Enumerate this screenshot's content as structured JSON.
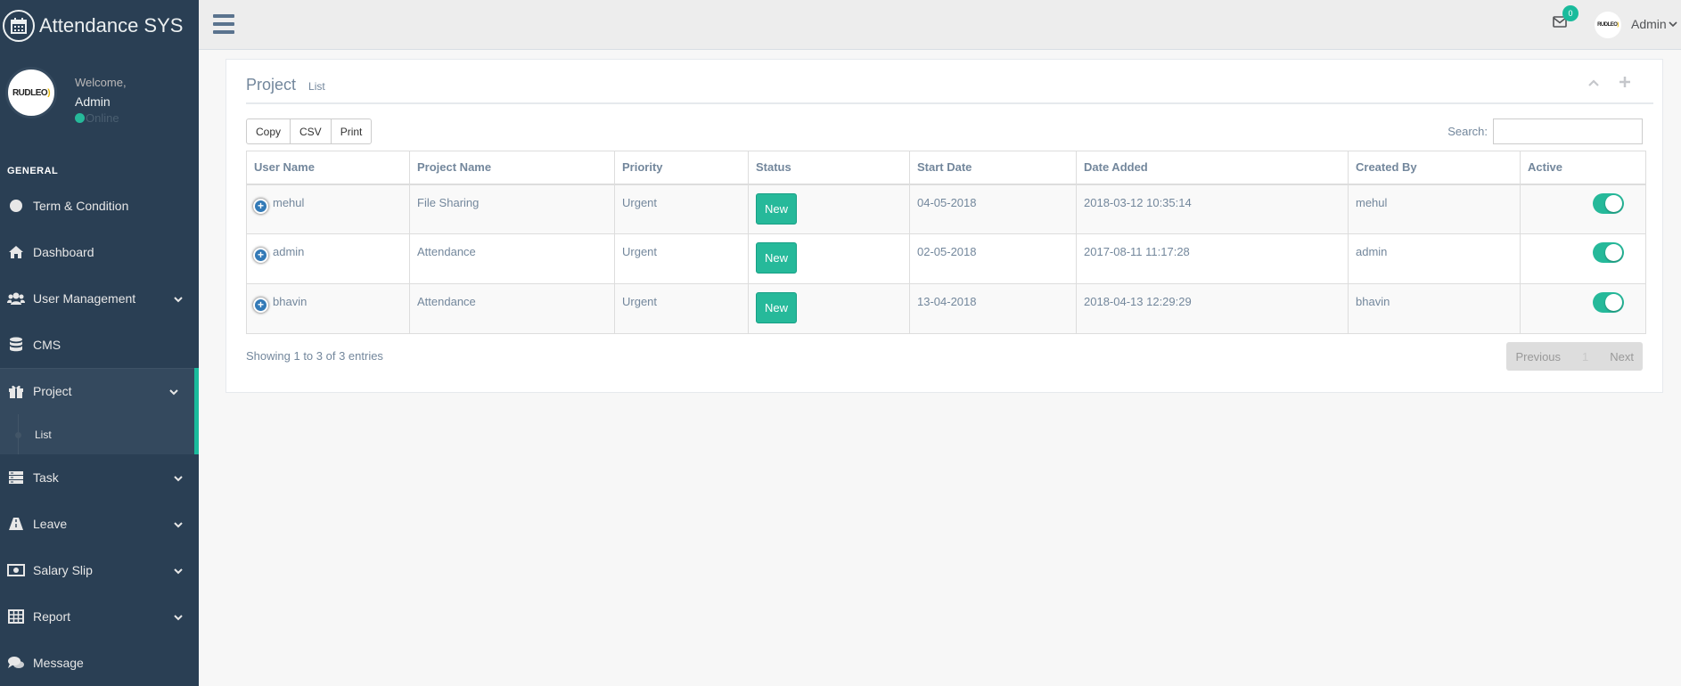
{
  "app": {
    "title": "Attendance SYS"
  },
  "profile": {
    "welcome": "Welcome,",
    "name": "Admin",
    "status": "Online"
  },
  "logo": {
    "text_main": "RUDLEO",
    "subtitle": ""
  },
  "sidebar": {
    "section": "GENERAL",
    "items": [
      {
        "label": "Term & Condition",
        "icon": "circle-icon"
      },
      {
        "label": "Dashboard",
        "icon": "home-icon"
      },
      {
        "label": "User Management",
        "icon": "users-icon"
      },
      {
        "label": "CMS",
        "icon": "database-icon"
      },
      {
        "label": "Project",
        "icon": "gift-icon"
      },
      {
        "label": "Task",
        "icon": "server-icon"
      },
      {
        "label": "Leave",
        "icon": "road-icon"
      },
      {
        "label": "Salary Slip",
        "icon": "money-icon"
      },
      {
        "label": "Report",
        "icon": "table-icon"
      },
      {
        "label": "Message",
        "icon": "comments-icon"
      }
    ],
    "submenu": {
      "label": "List"
    }
  },
  "topbar": {
    "mail_count": "0",
    "user": "Admin"
  },
  "panel": {
    "title": "Project",
    "subtitle": "List",
    "buttons": {
      "copy": "Copy",
      "csv": "CSV",
      "print": "Print"
    },
    "search_label": "Search:",
    "search_value": ""
  },
  "table": {
    "headers": [
      "User Name",
      "Project Name",
      "Priority",
      "Status",
      "Start Date",
      "Date Added",
      "Created By",
      "Active"
    ],
    "rows": [
      {
        "user": "mehul",
        "project": "File Sharing",
        "priority": "Urgent",
        "status": "New",
        "start": "04-05-2018",
        "added": "2018-03-12 10:35:14",
        "created_by": "mehul",
        "active": true
      },
      {
        "user": "admin",
        "project": "Attendance",
        "priority": "Urgent",
        "status": "New",
        "start": "02-05-2018",
        "added": "2017-08-11 11:17:28",
        "created_by": "admin",
        "active": true
      },
      {
        "user": "bhavin",
        "project": "Attendance",
        "priority": "Urgent",
        "status": "New",
        "start": "13-04-2018",
        "added": "2018-04-13 12:29:29",
        "created_by": "bhavin",
        "active": true
      }
    ]
  },
  "footer": {
    "showing": "Showing 1 to 3 of 3 entries",
    "previous": "Previous",
    "page": "1",
    "next": "Next"
  },
  "colors": {
    "sidebar": "#2A3F54",
    "accent": "#1ABB9C",
    "badge": "#26B99A"
  }
}
